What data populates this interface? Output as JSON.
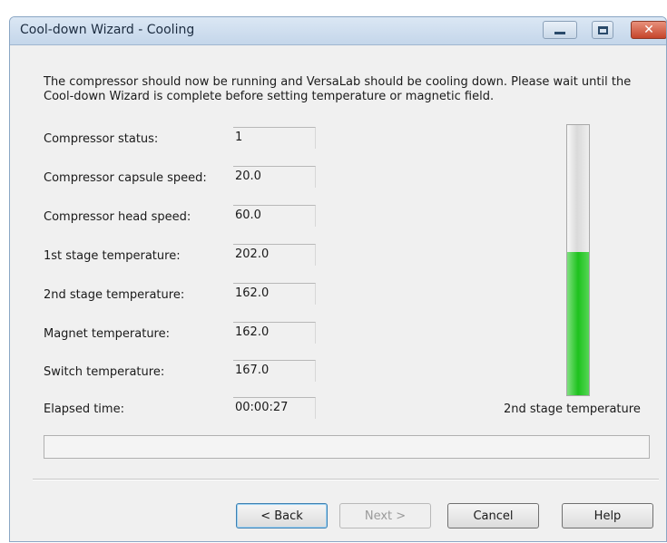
{
  "window": {
    "title": "Cool-down Wizard - Cooling",
    "buttons": {
      "minimize": "minimize",
      "maximize": "maximize",
      "close": "close"
    }
  },
  "instructions": "The compressor should now be running and VersaLab should be cooling down. Please wait until the Cool-down Wizard is complete before setting temperature or magnetic field.",
  "fields": [
    {
      "label": "Compressor status:",
      "value": "1"
    },
    {
      "label": "Compressor capsule speed:",
      "value": "20.0"
    },
    {
      "label": "Compressor head speed:",
      "value": "60.0"
    },
    {
      "label": "1st stage temperature:",
      "value": "202.0"
    },
    {
      "label": "2nd stage temperature:",
      "value": "162.0"
    },
    {
      "label": "Magnet temperature:",
      "value": "162.0"
    },
    {
      "label": "Switch temperature:",
      "value": "167.0"
    },
    {
      "label": "Elapsed time:",
      "value": "00:00:27"
    }
  ],
  "gauge": {
    "label": "2nd stage temperature",
    "fill_fraction": 0.53,
    "fill_color": "#22c322"
  },
  "status_text": "",
  "footer_buttons": {
    "back": "< Back",
    "next": "Next >",
    "cancel": "Cancel",
    "help": "Help"
  },
  "colors": {
    "titlebar": "#c4d6ea",
    "close_button": "#c5452b",
    "gauge_fill": "#22c322"
  }
}
